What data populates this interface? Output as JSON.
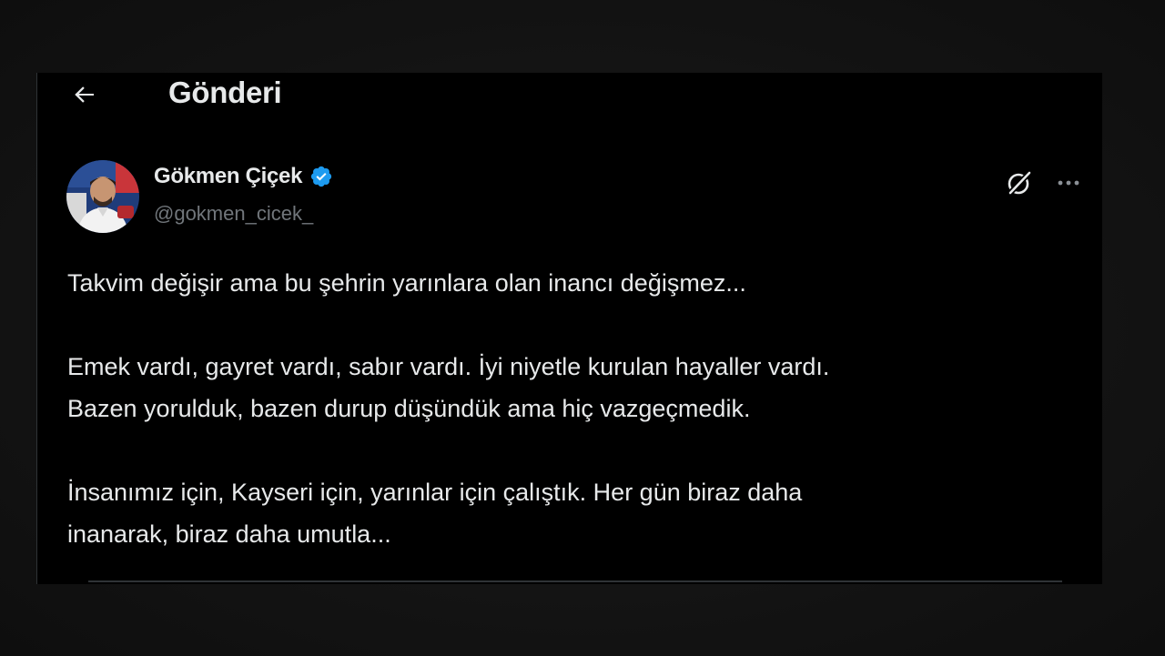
{
  "header": {
    "back_icon": "arrow-left-icon",
    "title": "Gönderi"
  },
  "post": {
    "author": {
      "name": "Gökmen Çiçek",
      "handle": "@gokmen_cicek_",
      "verified": true,
      "verified_icon": "verified-badge-icon",
      "verified_color": "#1d9bf0"
    },
    "actions": {
      "grok_icon": "grok-icon",
      "more_icon": "more-horizontal-icon"
    },
    "paragraphs": [
      {
        "lines": [
          "Takvim değişir ama bu şehrin yarınlara olan inancı değişmez..."
        ]
      },
      {
        "lines": [
          "Emek vardı, gayret vardı, sabır vardı. İyi niyetle kurulan hayaller vardı.",
          "Bazen yorulduk, bazen durup düşündük ama hiç vazgeçmedik."
        ]
      },
      {
        "lines": [
          "İnsanımız için, Kayseri için, yarınlar için çalıştık. Her gün biraz daha",
          "inanarak, biraz daha umutla..."
        ]
      }
    ]
  },
  "colors": {
    "background": "#000000",
    "text_primary": "#e7e9ea",
    "text_secondary": "#71767b",
    "divider": "#2f3336",
    "accent": "#1d9bf0"
  }
}
